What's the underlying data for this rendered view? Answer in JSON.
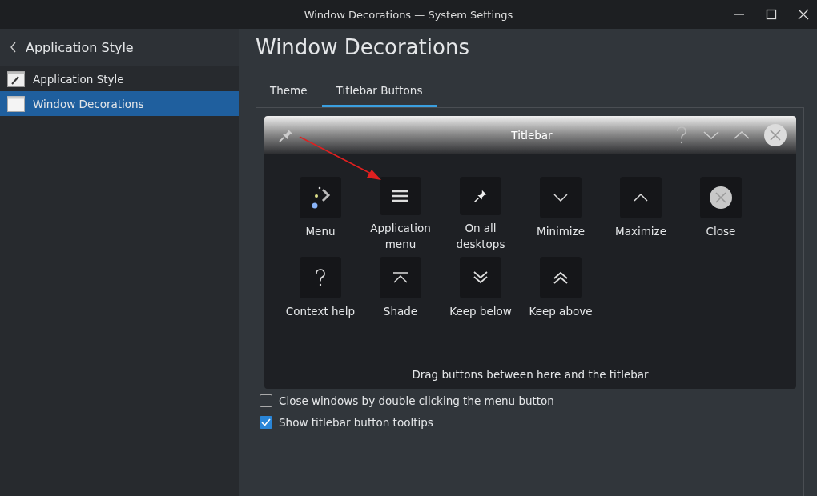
{
  "window": {
    "title": "Window Decorations — System Settings"
  },
  "sidebar": {
    "back_label": "Application Style",
    "items": [
      {
        "label": "Application Style",
        "kind": "style",
        "selected": false
      },
      {
        "label": "Window Decorations",
        "kind": "window",
        "selected": true
      }
    ]
  },
  "page": {
    "title": "Window Decorations"
  },
  "tabs": [
    {
      "label": "Theme",
      "selected": false
    },
    {
      "label": "Titlebar Buttons",
      "selected": true
    }
  ],
  "preview": {
    "title": "Titlebar",
    "left_buttons": [
      {
        "kind": "pin"
      }
    ],
    "right_buttons": [
      {
        "kind": "help"
      },
      {
        "kind": "minimize"
      },
      {
        "kind": "maximize"
      },
      {
        "kind": "close"
      }
    ]
  },
  "available_buttons": [
    {
      "label": "Menu",
      "kind": "menu"
    },
    {
      "label": "Application menu",
      "kind": "appmenu"
    },
    {
      "label": "On all desktops",
      "kind": "pin"
    },
    {
      "label": "Minimize",
      "kind": "minimize"
    },
    {
      "label": "Maximize",
      "kind": "maximize"
    },
    {
      "label": "Close",
      "kind": "close"
    },
    {
      "label": "Context help",
      "kind": "help"
    },
    {
      "label": "Shade",
      "kind": "shade"
    },
    {
      "label": "Keep below",
      "kind": "keepbelow"
    },
    {
      "label": "Keep above",
      "kind": "keepabove"
    }
  ],
  "hint": "Drag buttons between here and the titlebar",
  "options": [
    {
      "label": "Close windows by double clicking the menu button",
      "checked": false
    },
    {
      "label": "Show titlebar button tooltips",
      "checked": true
    }
  ]
}
